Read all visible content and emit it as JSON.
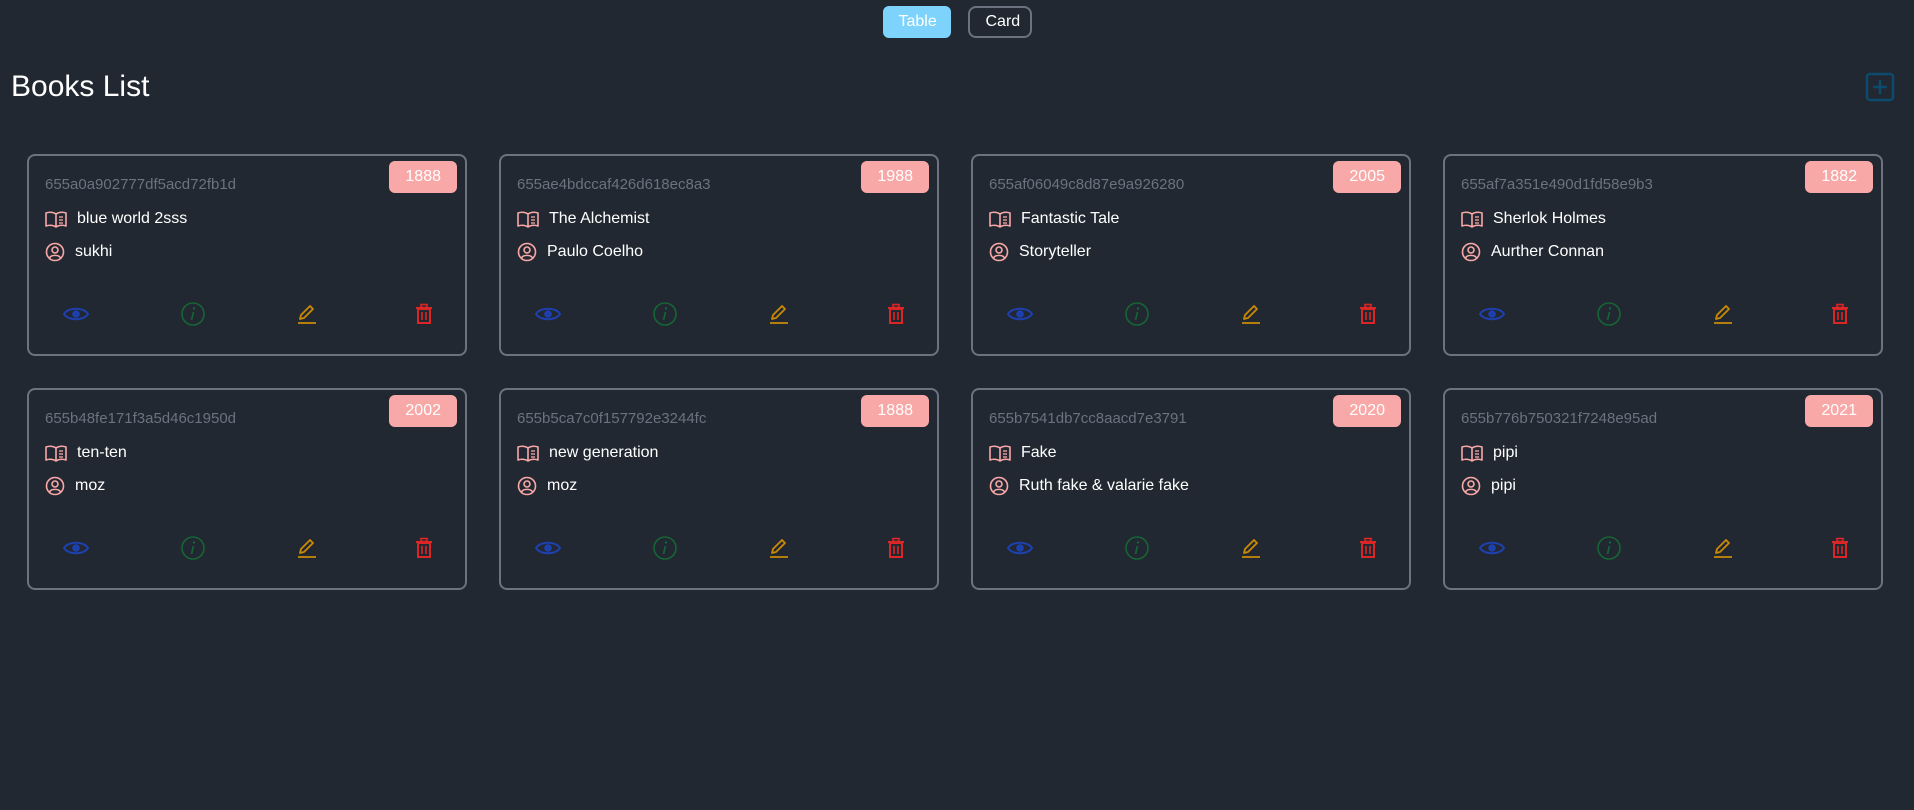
{
  "header": {
    "buttons": {
      "table_label": "Table",
      "card_label": "Card"
    },
    "title": "Books List",
    "add_icon": "plus-square-icon"
  },
  "colors": {
    "background": "#222831",
    "accent_button": "#7dd3fc",
    "year_badge": "#f9a8a8",
    "view_icon": "#1e40af",
    "info_icon": "#166534",
    "edit_icon": "#ca8a04",
    "delete_icon": "#dc2626",
    "book_icon": "#f9a8a8"
  },
  "books": [
    {
      "id": "655a0a902777df5acd72fb1d",
      "year": "1888",
      "title": "blue world 2sss",
      "author": "sukhi"
    },
    {
      "id": "655ae4bdccaf426d618ec8a3",
      "year": "1988",
      "title": "The Alchemist",
      "author": "Paulo Coelho"
    },
    {
      "id": "655af06049c8d87e9a926280",
      "year": "2005",
      "title": "Fantastic Tale",
      "author": "Storyteller"
    },
    {
      "id": "655af7a351e490d1fd58e9b3",
      "year": "1882",
      "title": "Sherlok Holmes",
      "author": "Aurther Connan"
    },
    {
      "id": "655b48fe171f3a5d46c1950d",
      "year": "2002",
      "title": "ten-ten",
      "author": "moz"
    },
    {
      "id": "655b5ca7c0f157792e3244fc",
      "year": "1888",
      "title": "new generation",
      "author": "moz"
    },
    {
      "id": "655b7541db7cc8aacd7e3791",
      "year": "2020",
      "title": "Fake",
      "author": "Ruth fake & valarie fake"
    },
    {
      "id": "655b776b750321f7248e95ad",
      "year": "2021",
      "title": "pipi",
      "author": "pipi"
    }
  ],
  "card_icons": {
    "title": "open-book-icon",
    "author": "user-circle-icon",
    "actions": [
      "eye-icon",
      "info-circle-icon",
      "pencil-icon",
      "trash-icon"
    ]
  }
}
